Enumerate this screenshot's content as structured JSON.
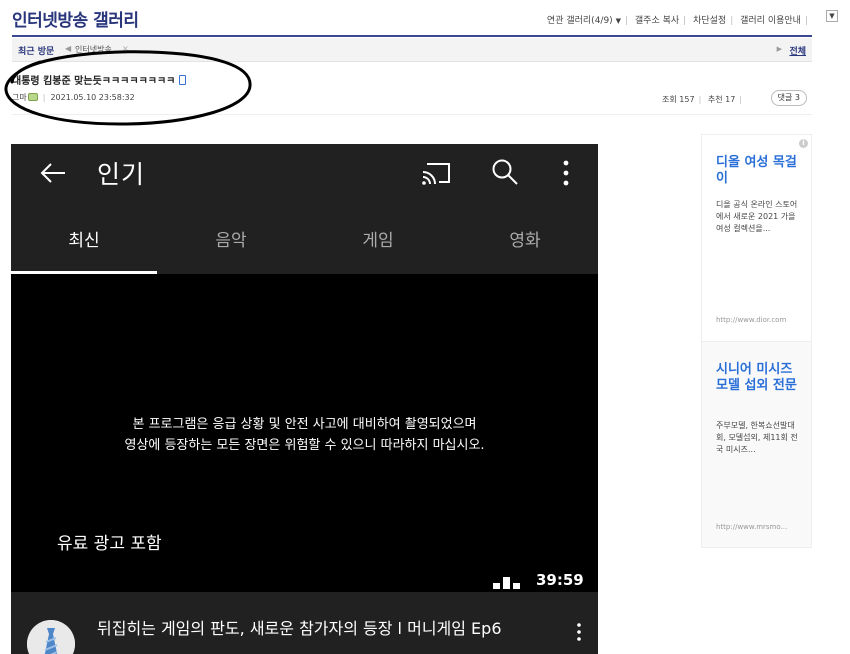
{
  "header": {
    "gallery_title": "인터넷방송 갤러리",
    "links": [
      "연관 갤러리(4/9)",
      "갤주소 복사",
      "차단설정",
      "갤러리 이용안내"
    ],
    "dropdown_icon": "triangle-down"
  },
  "visit_bar": {
    "label": "최근 방문",
    "item": "인터넷방송",
    "close_glyph": "×",
    "all_label": "전체"
  },
  "post": {
    "title": "대통령 킴봉준 맞는듯ㅋㅋㅋㅋㅋㅋㅋㅋ",
    "author": "그마",
    "date": "2021.05.10 23:58:32",
    "views_label": "조회",
    "views": "157",
    "recommend_label": "추천",
    "recommend": "17",
    "comment_button": "댓글 3"
  },
  "screenshot": {
    "app_title": "인기",
    "tabs": [
      "최신",
      "음악",
      "게임",
      "영화"
    ],
    "active_tab": 0,
    "notice_lines": [
      "본 프로그램은 응급 상황 및 안전 사고에 대비하여 촬영되었으며",
      "영상에 등장하는 모든 장면은 위험할 수 있으니 따라하지 마십시오."
    ],
    "ad_text": "유료 광고 포함",
    "duration": "39:59",
    "video_title": "뒤집히는 게임의 판도, 새로운 참가자의 등장 l 머니게임 Ep6",
    "colors": {
      "bar": "#212121",
      "video_bg": "#000000",
      "text": "#ffffff"
    }
  },
  "side_ad": {
    "items": [
      {
        "headline": "디올 여성 목걸이",
        "description": "디올 공식 온라인 스토어에서 새로운 2021 가을 여성 컬렉션을...",
        "url": "http://www.dior.com"
      },
      {
        "headline": "시니어 미시즈모델 섭외 전문",
        "description": "주부모델, 한복쇼선발대회, 모델섭외, 제11회 전국 미시즈...",
        "url": "http://www.mrsmo..."
      }
    ],
    "headline_color": "#2a6fd8"
  },
  "colors": {
    "brand": "#29367c",
    "title_underline": "#3b4890"
  }
}
